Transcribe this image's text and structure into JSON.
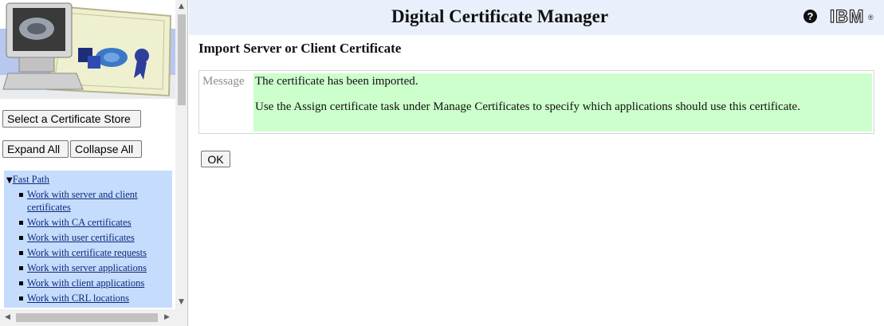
{
  "app": {
    "title": "Digital Certificate Manager",
    "brand": "IBM",
    "brand_mark": "®"
  },
  "sidebar": {
    "select_store_label": "Select a Certificate Store",
    "expand_all_label": "Expand All",
    "collapse_all_label": "Collapse All",
    "fast_path_label": "Fast Path",
    "tasks": [
      {
        "label": "Work with server and client certificates"
      },
      {
        "label": "Work with CA certificates"
      },
      {
        "label": "Work with user certificates"
      },
      {
        "label": "Work with certificate requests"
      },
      {
        "label": "Work with server applications"
      },
      {
        "label": "Work with client applications"
      },
      {
        "label": "Work with CRL locations"
      }
    ]
  },
  "main": {
    "page_title": "Import Server or Client Certificate",
    "message_label": "Message",
    "message_line1": "The certificate has been imported.",
    "message_line2": "Use the Assign certificate task under Manage Certificates to specify which applications should use this certificate.",
    "ok_label": "OK"
  },
  "colors": {
    "header_bg": "#e9f0fc",
    "nav_bg": "#c6dcfc",
    "message_bg": "#ccffcc",
    "link": "#0b2a7a"
  },
  "icons": [
    "help-icon",
    "ibm-logo",
    "certificate-illustration",
    "expand-triangle-icon"
  ]
}
